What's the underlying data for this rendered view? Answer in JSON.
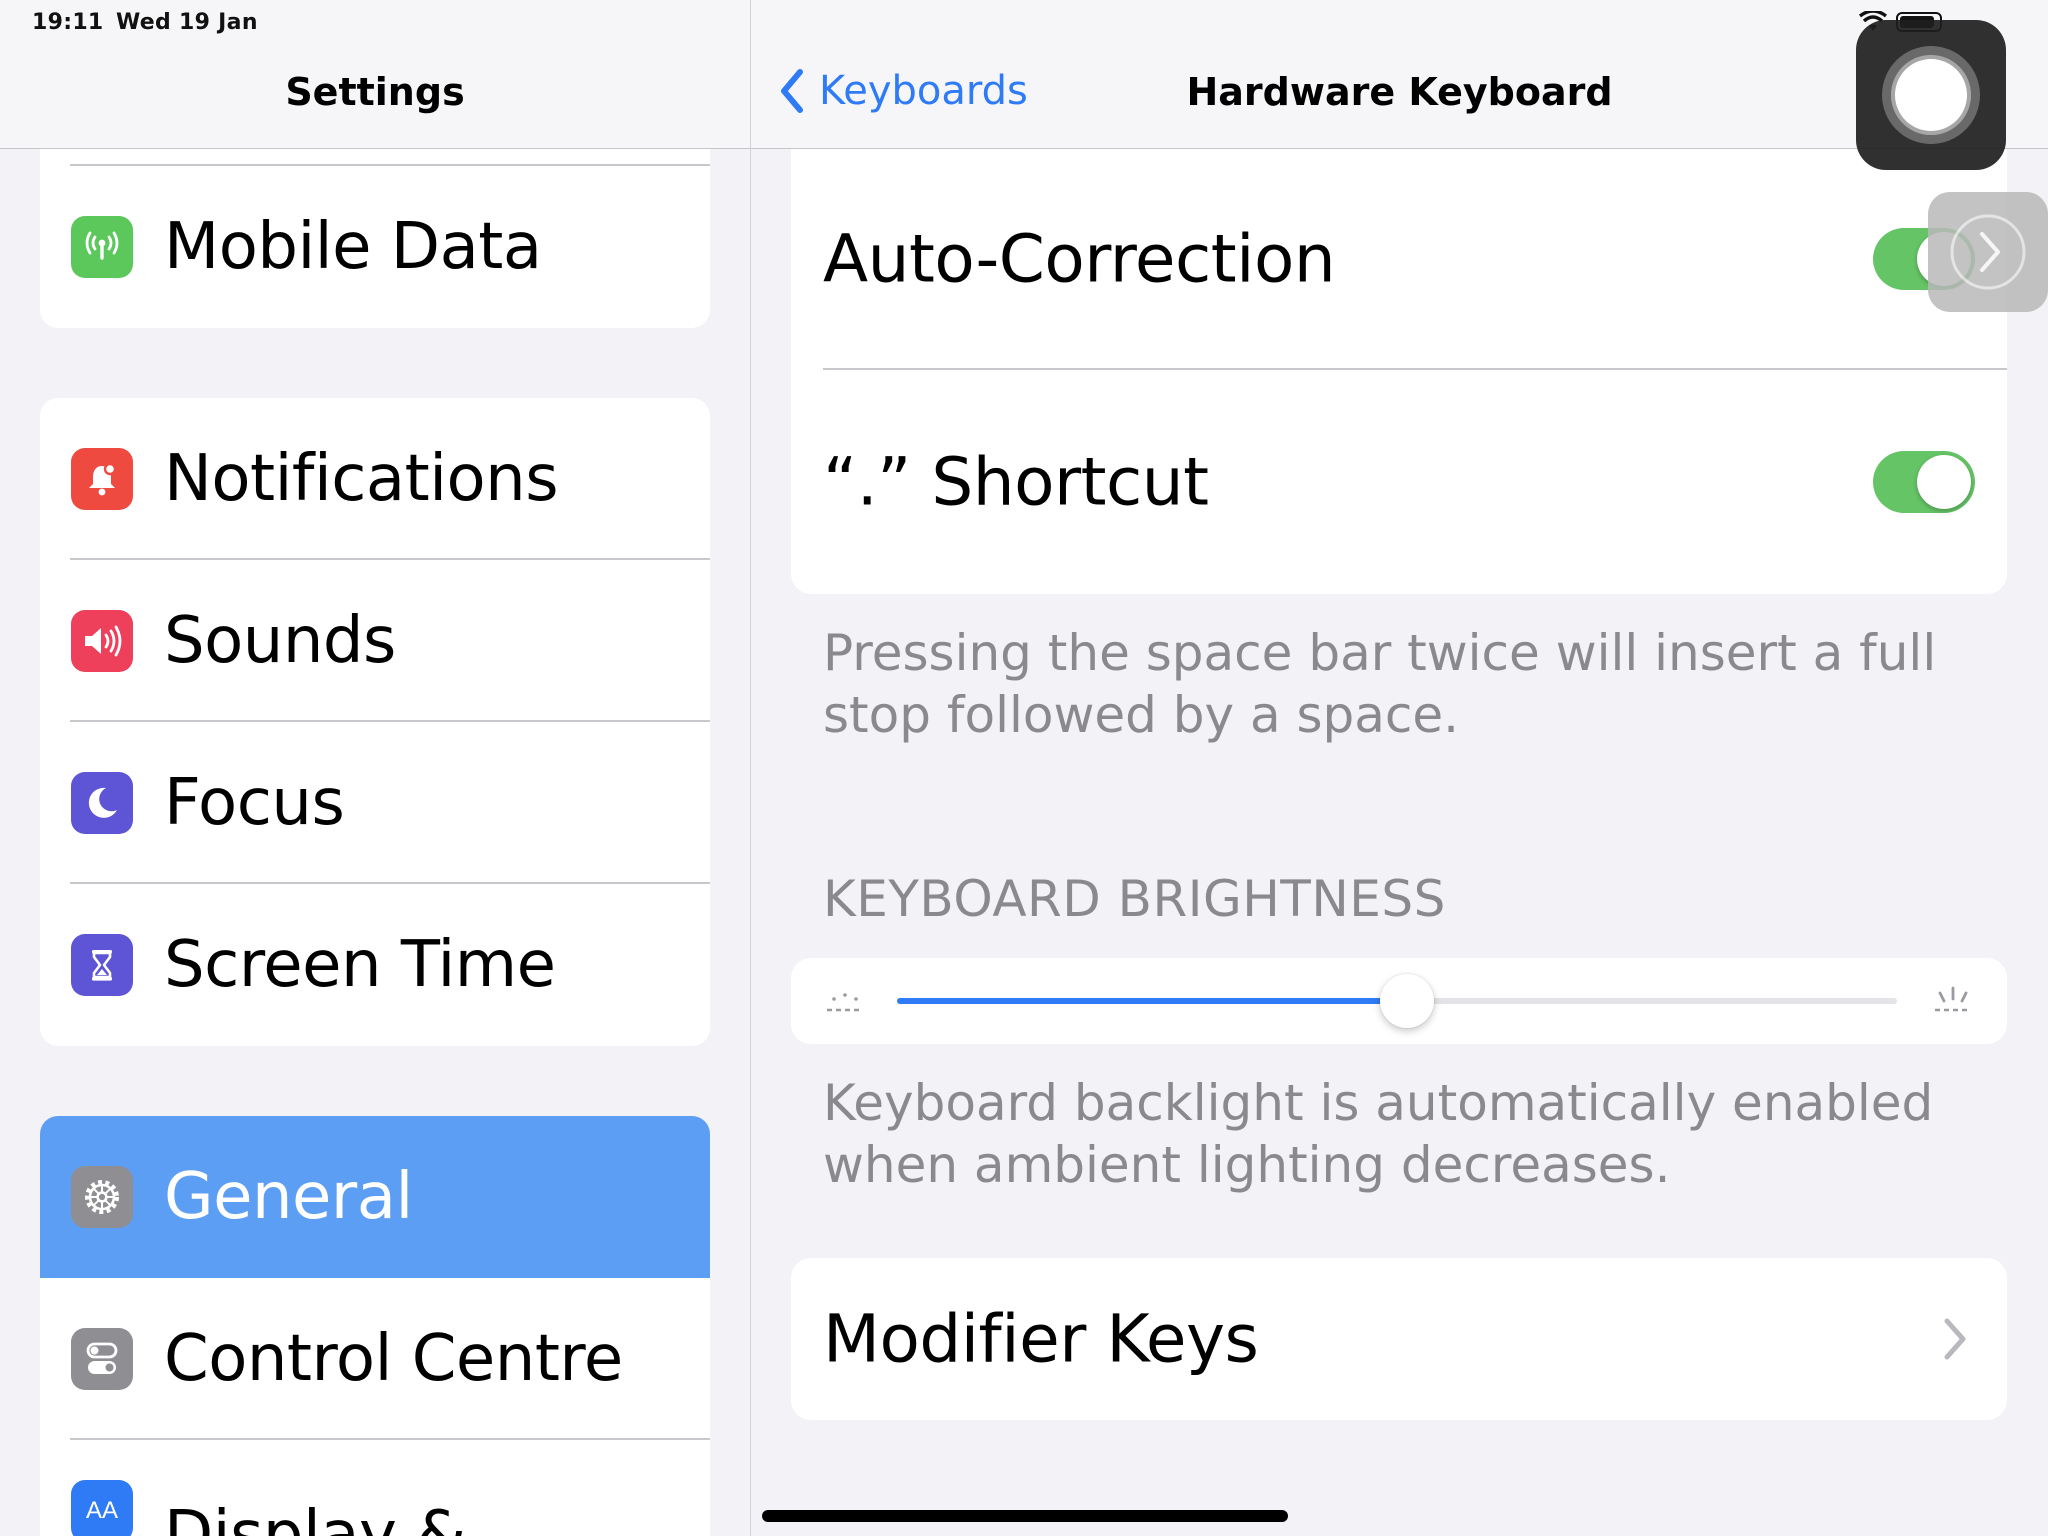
{
  "status_bar": {
    "time": "19:11",
    "date": "Wed 19 Jan"
  },
  "sidebar": {
    "title": "Settings",
    "items": [
      {
        "label": "Mobile Data",
        "icon": "antenna-icon",
        "color": "#5cc85b"
      },
      {
        "label": "Notifications",
        "icon": "bell-icon",
        "color": "#ef4a3f"
      },
      {
        "label": "Sounds",
        "icon": "speaker-icon",
        "color": "#ee3f5b"
      },
      {
        "label": "Focus",
        "icon": "moon-icon",
        "color": "#5d55d6"
      },
      {
        "label": "Screen Time",
        "icon": "hourglass-icon",
        "color": "#5d55d6"
      },
      {
        "label": "General",
        "icon": "gear-icon",
        "color": "#8e8e93",
        "selected": true
      },
      {
        "label": "Control Centre",
        "icon": "toggles-icon",
        "color": "#8e8e93"
      },
      {
        "label": "Display &",
        "icon": "text-size-icon",
        "color": "#2f7bf5"
      }
    ]
  },
  "detail": {
    "back_label": "Keyboards",
    "title": "Hardware Keyboard",
    "rows": [
      {
        "label": "Auto-Correction",
        "toggle": true
      },
      {
        "label": "“.” Shortcut",
        "toggle": true
      }
    ],
    "shortcut_footer": "Pressing the space bar twice will insert a full stop followed by a space.",
    "brightness_header": "KEYBOARD BRIGHTNESS",
    "brightness_value": 0.51,
    "brightness_footer": "Keyboard backlight is automatically enabled when ambient lighting decreases.",
    "modifier_keys_label": "Modifier Keys"
  },
  "colors": {
    "accent": "#2f7bf5",
    "toggle_on": "#65c466",
    "selected_row": "#5d9ef5",
    "background": "#f2f2f7",
    "secondary_text": "#8a8a8e"
  }
}
